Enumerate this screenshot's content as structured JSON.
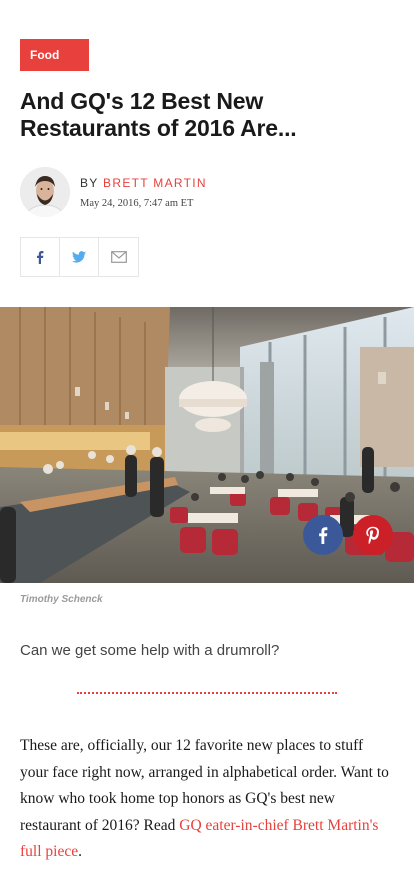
{
  "article": {
    "category": "Food",
    "headline": "And GQ's 12 Best New Restaurants of 2016 Are...",
    "byline_prefix": "BY",
    "author": "BRETT MARTIN",
    "date": "May 24, 2016, 7:47 am ET",
    "photo_credit": "Timothy Schenck",
    "dek": "Can we get some help with a drumroll?",
    "body_text": "These are, officially, our 12 favorite new places to stuff your face right now, arranged in alphabetical order. Want to know who took home top honors as GQ's best new restaurant of 2016? Read",
    "body_link": "GQ eater-in-chief Brett Martin's full piece",
    "body_end": "."
  },
  "colors": {
    "accent": "#e8403c",
    "facebook": "#3b5998",
    "twitter": "#55acee",
    "pinterest": "#cb2027"
  },
  "icons": {
    "share_bar": [
      "facebook-icon",
      "twitter-icon",
      "mail-icon"
    ],
    "image_overlay": [
      "facebook-icon",
      "pinterest-icon"
    ]
  }
}
